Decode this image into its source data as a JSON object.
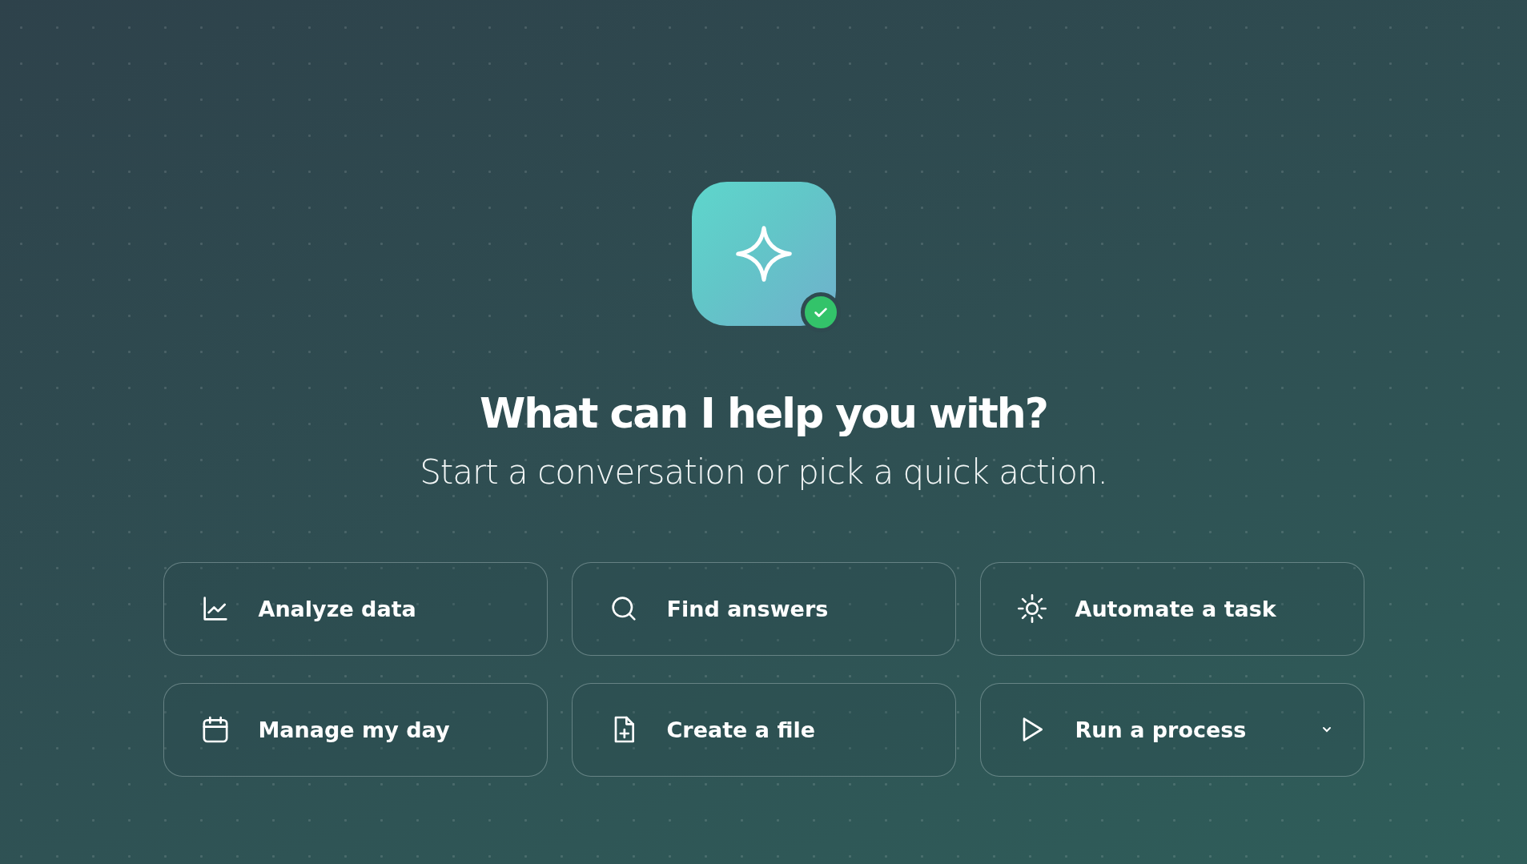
{
  "assistant": {
    "online": true
  },
  "heading": "What can I help you with?",
  "subtitle": "Start a conversation or pick a quick action.",
  "actions": [
    {
      "label": "Analyze data",
      "has_menu": false
    },
    {
      "label": "Find answers",
      "has_menu": false
    },
    {
      "label": "Automate a task",
      "has_menu": false
    },
    {
      "label": "Manage my day",
      "has_menu": false
    },
    {
      "label": "Create a file",
      "has_menu": false
    },
    {
      "label": "Run a process",
      "has_menu": true
    }
  ]
}
